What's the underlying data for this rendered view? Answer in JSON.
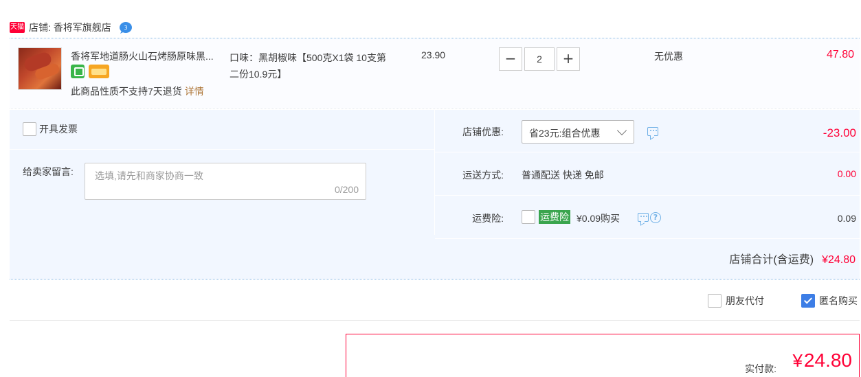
{
  "shop": {
    "badge": "天猫",
    "name": "店铺: 香将军旗舰店",
    "wangwang_count": "3"
  },
  "item": {
    "title": "香将军地道肠火山石烤肠原味黑...",
    "sku": "口味：黑胡椒味【500克X1袋 10支第二份10.9元】",
    "return_note": "此商品性质不支持7天退货",
    "detail_link": "详情",
    "unit_price": "23.90",
    "qty_minus": "−",
    "quantity": "2",
    "qty_plus": "+",
    "discount": "无优惠",
    "total": "47.80"
  },
  "invoice": {
    "label": "开具发票"
  },
  "message": {
    "label": "给卖家留言:",
    "placeholder": "选填,请先和商家协商一致",
    "counter": "0/200"
  },
  "store_discount": {
    "label": "店铺优惠:",
    "selected": "省23元:组合优惠",
    "value": "-23.00"
  },
  "shipping": {
    "label": "运送方式:",
    "method": "普通配送 快递 免邮",
    "value": "0.00"
  },
  "insurance": {
    "label": "运费险:",
    "tag": "运费险",
    "price": "¥0.09购买",
    "value": "0.09"
  },
  "shop_total": {
    "label": "店铺合计(含运费)",
    "amount": "¥24.80"
  },
  "footer": {
    "friend_pay": "朋友代付",
    "anonymous": "匿名购买"
  },
  "payment": {
    "label": "实付款:",
    "currency": "¥",
    "amount": "24.80"
  },
  "colors": {
    "price_red": "#ff0036",
    "panel_bg": "#f2f7ff",
    "link_brown": "#b07a3d",
    "insurance_green": "#3aa54e",
    "check_blue": "#3d7ee6"
  }
}
